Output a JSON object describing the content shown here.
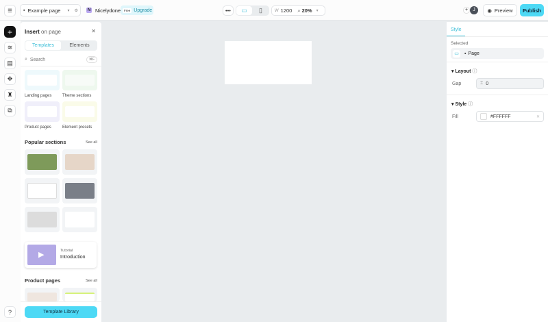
{
  "topbar": {
    "page_name": "Example page",
    "workspace_initial": "N",
    "workspace": "Nicelydone",
    "plan_badge": "Free",
    "upgrade": "Upgrade",
    "width_label": "W",
    "width_value": "1200",
    "zoom": "20%",
    "avatar_initial": "J",
    "preview": "Preview",
    "publish": "Publish"
  },
  "insert_panel": {
    "title": "Insert",
    "title_suffix": "on page",
    "tabs": [
      "Templates",
      "Elements"
    ],
    "search_placeholder": "Search",
    "search_shortcut": "⌘F",
    "categories": [
      "Landing pages",
      "Theme sections",
      "Product pages",
      "Element presets"
    ],
    "popular_title": "Popular sections",
    "see_all": "See all",
    "tutorial": {
      "kicker": "Tutorial",
      "title": "Introduction"
    },
    "product_pages_title": "Product pages",
    "template_library": "Template Library"
  },
  "style_panel": {
    "tab": "Style",
    "selected_label": "Selected",
    "selected_value": "Page",
    "layout_title": "Layout",
    "gap_label": "Gap",
    "gap_value": "0",
    "style_title": "Style",
    "fill_label": "Fill",
    "fill_value": "#FFFFFF"
  },
  "colors": {
    "accent": "#3ebfd8",
    "publish_bg": "#4dd9f5",
    "canvas": "#e9ecee"
  }
}
